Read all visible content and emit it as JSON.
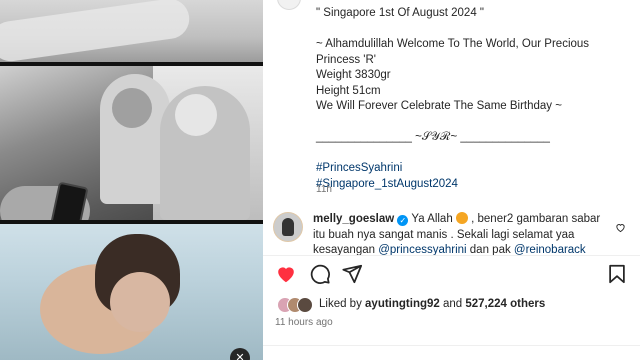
{
  "caption": {
    "line1": "\" Singapore 1st Of August 2024 \"",
    "line2": "~ Alhamdulillah Welcome To The World, Our Precious",
    "line3": "Princess 'R'",
    "line4": "Weight 3830gr",
    "line5": "Height 51cm",
    "line6": "We Will Forever Celebrate The Same Birthday ~",
    "signature": "_______________ ~𝒮𝒴ℛ~ ______________",
    "hashtag1": "#PrincesSyahrini",
    "hashtag2": "#Singapore_1stAugust2024",
    "time": "11h"
  },
  "comment": {
    "username": "melly_goeslaw",
    "text_a": " Ya Allah ",
    "text_b": " , bener2 gambaran sabar",
    "line2": "itu buah nya sangat manis . Sekali lagi selamat yaa",
    "line3_a": "kesayangan ",
    "mention1": "@princessyahrini",
    "line3_b": " dan pak ",
    "mention2": "@reinobarack",
    "icon": "heart-outline-icon"
  },
  "actions": {
    "like_icon": "heart-filled-icon",
    "comment_icon": "comment-icon",
    "share_icon": "paper-plane-icon",
    "save_icon": "bookmark-icon",
    "like_color": "#ff3040"
  },
  "likes": {
    "prefix": "Liked by ",
    "user": "ayutingting92",
    "middle": " and ",
    "count": "527,224 others",
    "ago": "11 hours ago"
  },
  "media": {
    "sound_icon": "mute-icon"
  }
}
